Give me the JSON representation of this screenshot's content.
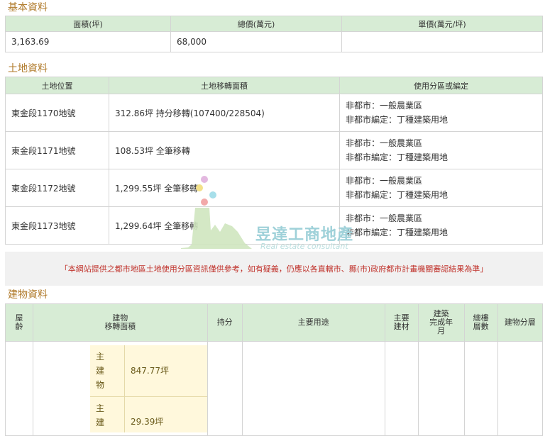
{
  "basic": {
    "title": "基本資料",
    "headers": [
      "面積(坪)",
      "總價(萬元)",
      "單價(萬元/坪)"
    ],
    "values": [
      "3,163.69",
      "68,000",
      ""
    ]
  },
  "land": {
    "title": "土地資料",
    "headers": [
      "土地位置",
      "土地移轉面積",
      "使用分區或編定"
    ],
    "rows": [
      {
        "location": "東金段1170地號",
        "area": "312.86坪 持分移轉(107400/228504)",
        "zone": "非都市：一般農業區",
        "zoning": "非都市編定：丁種建築用地"
      },
      {
        "location": "東金段1171地號",
        "area": "108.53坪 全筆移轉",
        "zone": "非都市：一般農業區",
        "zoning": "非都市編定：丁種建築用地"
      },
      {
        "location": "東金段1172地號",
        "area": "1,299.55坪 全筆移轉",
        "zone": "非都市：一般農業區",
        "zoning": "非都市編定：丁種建築用地"
      },
      {
        "location": "東金段1173地號",
        "area": "1,299.64坪 全筆移轉",
        "zone": "非都市：一般農業區",
        "zoning": "非都市編定：丁種建築用地"
      }
    ]
  },
  "notice": "「本網站提供之都市地區土地使用分區資訊僅供參考，如有疑義，仍應以各直轄市、縣(市)政府都市計畫機關審認結果為準」",
  "building": {
    "title": "建物資料",
    "headers": {
      "age": "屋\n齡",
      "area": "建物\n移轉面積",
      "share": "持分",
      "use": "主要用途",
      "material": "主要\n建材",
      "completed": "建築\n完成年\n月",
      "floors": "總樓\n層數",
      "floor": "建物分層"
    },
    "rows": [
      {
        "type": "主\n建\n物",
        "area": "847.77坪"
      },
      {
        "type": "主\n建",
        "area": "29.39坪"
      }
    ]
  },
  "watermark": {
    "name": "昱達工商地產",
    "english": "Real estate consultant"
  },
  "colors": {
    "header_bg": "#d7ecd5",
    "title": "#b07a2a",
    "notice_text": "#c0322b",
    "cell_highlight": "#fff8dc"
  }
}
